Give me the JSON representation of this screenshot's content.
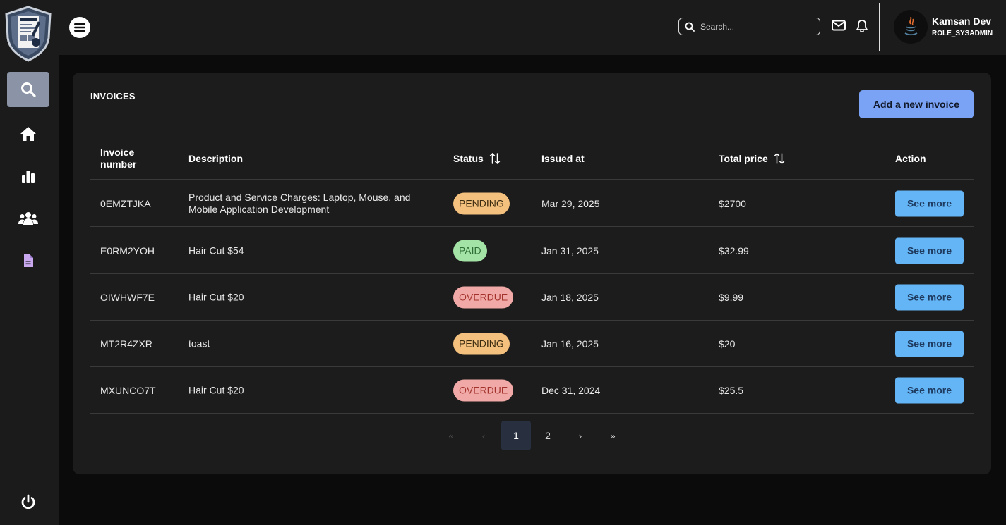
{
  "header": {
    "search_placeholder": "Search...",
    "user": {
      "name": "Kamsan Dev",
      "role": "ROLE_SYSADMIN"
    }
  },
  "sidebar": {
    "items": [
      {
        "icon": "search-icon",
        "active": true
      },
      {
        "icon": "home-icon",
        "active": false
      },
      {
        "icon": "chart-icon",
        "active": false
      },
      {
        "icon": "users-icon",
        "active": false
      },
      {
        "icon": "document-icon",
        "active": false
      },
      {
        "icon": "power-icon",
        "active": false
      }
    ]
  },
  "invoices": {
    "title": "INVOICES",
    "add_label": "Add a new invoice",
    "columns": {
      "number": "Invoice number",
      "description": "Description",
      "status": "Status",
      "issued": "Issued at",
      "total": "Total price",
      "action": "Action"
    },
    "rows": [
      {
        "number": "0EMZTJKA",
        "description": "Product and Service Charges: Laptop, Mouse, and Mobile Application Development",
        "status": "PENDING",
        "issued": "Mar 29, 2025",
        "total": "$2700",
        "action": "See more"
      },
      {
        "number": "E0RM2YOH",
        "description": "Hair Cut $54",
        "status": "PAID",
        "issued": "Jan 31, 2025",
        "total": "$32.99",
        "action": "See more"
      },
      {
        "number": "OIWHWF7E",
        "description": "Hair Cut $20",
        "status": "OVERDUE",
        "issued": "Jan 18, 2025",
        "total": "$9.99",
        "action": "See more"
      },
      {
        "number": "MT2R4ZXR",
        "description": "toast",
        "status": "PENDING",
        "issued": "Jan 16, 2025",
        "total": "$20",
        "action": "See more"
      },
      {
        "number": "MXUNCO7T",
        "description": "Hair Cut $20",
        "status": "OVERDUE",
        "issued": "Dec 31, 2024",
        "total": "$25.5",
        "action": "See more"
      }
    ]
  },
  "pagination": {
    "first": "«",
    "prev": "‹",
    "pages": [
      "1",
      "2"
    ],
    "current": "1",
    "next": "›",
    "last": "»"
  },
  "colors": {
    "pending": "#f4c07d",
    "paid": "#a3e3a6",
    "overdue": "#f0a9a6",
    "primary_button": "#7ba3f5",
    "see_more_button": "#64b5f6"
  }
}
